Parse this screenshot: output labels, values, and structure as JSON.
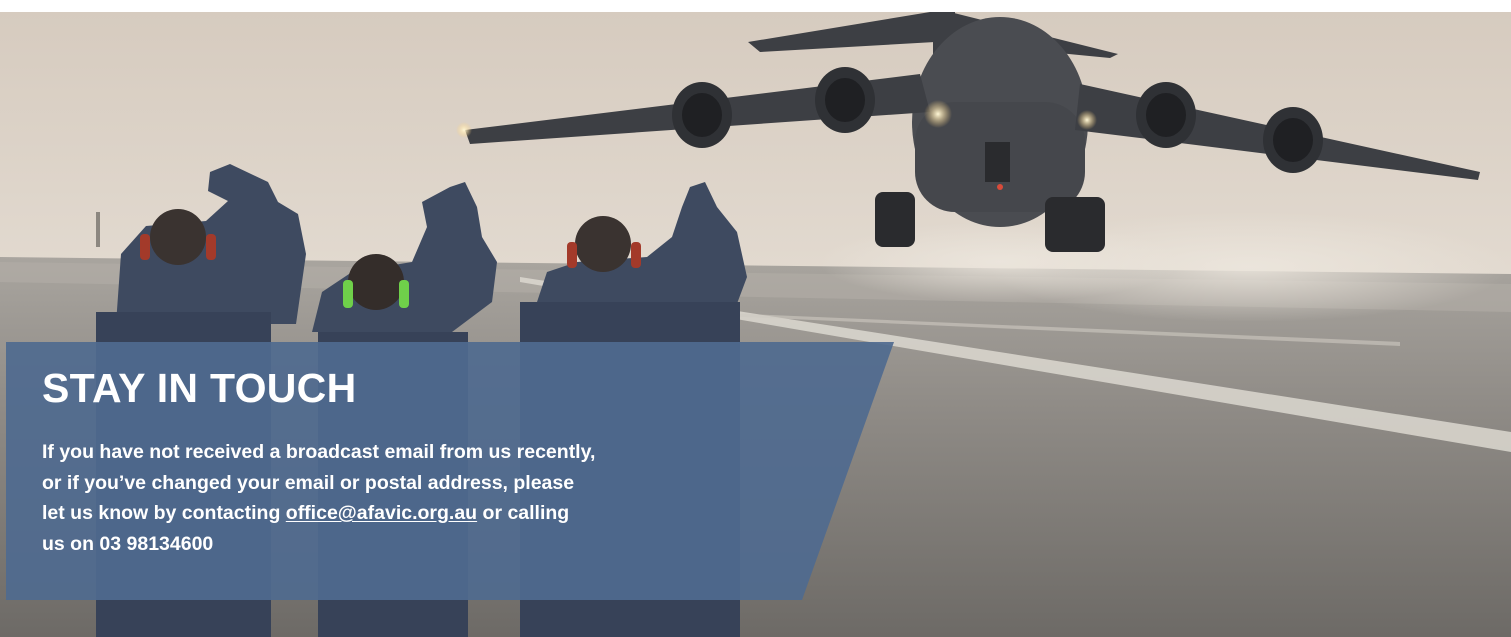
{
  "banner": {
    "image_alt": "Air force C-17 aircraft taking off while three personnel with ear protection wave from the runway",
    "colors": {
      "panel": "#4f6a8f",
      "text": "#ffffff"
    }
  },
  "stay_in_touch": {
    "title": "STAY IN TOUCH",
    "line1": "If you have not received a broadcast email from us recently,",
    "line2": "or if you’ve changed your email or postal address, please",
    "line3_before": "let us know by contacting ",
    "email_link": "office@afavic.org.au",
    "line3_after": " or calling",
    "line4": "us on 03 98134600"
  }
}
